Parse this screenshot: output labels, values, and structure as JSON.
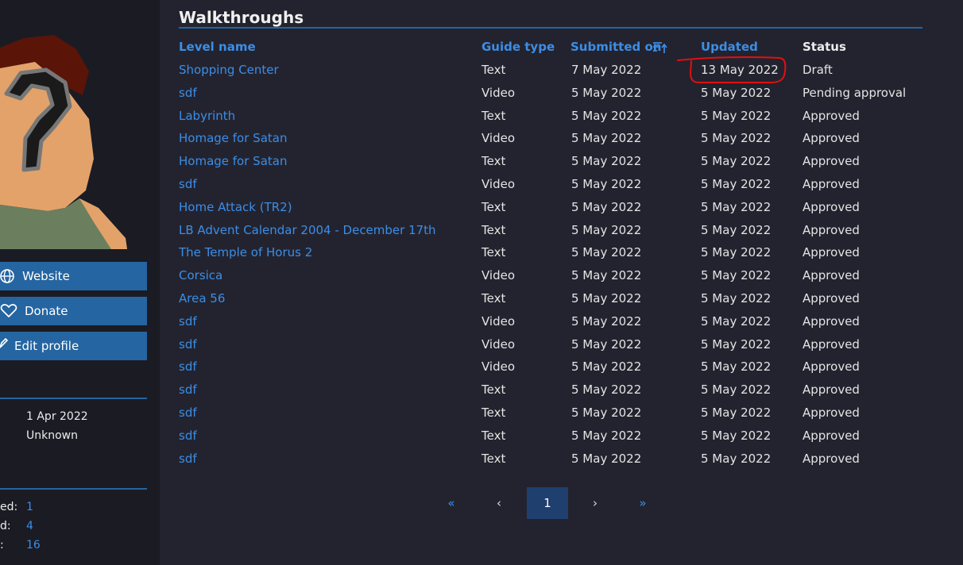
{
  "sidebar": {
    "avatar_icon": "unknown-person-avatar",
    "buttons": [
      {
        "label": "Website",
        "icon": "globe-icon"
      },
      {
        "label": "Donate",
        "icon": "heart-icon"
      },
      {
        "label": "Edit profile",
        "icon": "pencil-icon"
      }
    ],
    "info": {
      "joined_value": "1 Apr 2022",
      "last_value": "Unknown"
    },
    "stats": [
      {
        "label": "ed:",
        "value": "1"
      },
      {
        "label": "d:",
        "value": "4"
      },
      {
        "label": ":",
        "value": "16"
      }
    ]
  },
  "walkthroughs": {
    "title": "Walkthroughs",
    "columns": {
      "level_name": "Level name",
      "guide_type": "Guide type",
      "submitted_on": "Submitted on",
      "updated": "Updated",
      "status": "Status"
    },
    "sort_icon": "sort-ascending-icon",
    "rows": [
      {
        "name": "Shopping Center",
        "type": "Text",
        "submitted": "7 May 2022",
        "updated": "13 May 2022",
        "status": "Draft"
      },
      {
        "name": "sdf",
        "type": "Video",
        "submitted": "5 May 2022",
        "updated": "5 May 2022",
        "status": "Pending approval"
      },
      {
        "name": "Labyrinth",
        "type": "Text",
        "submitted": "5 May 2022",
        "updated": "5 May 2022",
        "status": "Approved"
      },
      {
        "name": "Homage for Satan",
        "type": "Video",
        "submitted": "5 May 2022",
        "updated": "5 May 2022",
        "status": "Approved"
      },
      {
        "name": "Homage for Satan",
        "type": "Text",
        "submitted": "5 May 2022",
        "updated": "5 May 2022",
        "status": "Approved"
      },
      {
        "name": "sdf",
        "type": "Video",
        "submitted": "5 May 2022",
        "updated": "5 May 2022",
        "status": "Approved"
      },
      {
        "name": "Home Attack (TR2)",
        "type": "Text",
        "submitted": "5 May 2022",
        "updated": "5 May 2022",
        "status": "Approved"
      },
      {
        "name": "LB Advent Calendar 2004 - December 17th",
        "type": "Text",
        "submitted": "5 May 2022",
        "updated": "5 May 2022",
        "status": "Approved"
      },
      {
        "name": "The Temple of Horus 2",
        "type": "Text",
        "submitted": "5 May 2022",
        "updated": "5 May 2022",
        "status": "Approved"
      },
      {
        "name": "Corsica",
        "type": "Video",
        "submitted": "5 May 2022",
        "updated": "5 May 2022",
        "status": "Approved"
      },
      {
        "name": "Area 56",
        "type": "Text",
        "submitted": "5 May 2022",
        "updated": "5 May 2022",
        "status": "Approved"
      },
      {
        "name": "sdf",
        "type": "Video",
        "submitted": "5 May 2022",
        "updated": "5 May 2022",
        "status": "Approved"
      },
      {
        "name": "sdf",
        "type": "Video",
        "submitted": "5 May 2022",
        "updated": "5 May 2022",
        "status": "Approved"
      },
      {
        "name": "sdf",
        "type": "Video",
        "submitted": "5 May 2022",
        "updated": "5 May 2022",
        "status": "Approved"
      },
      {
        "name": "sdf",
        "type": "Text",
        "submitted": "5 May 2022",
        "updated": "5 May 2022",
        "status": "Approved"
      },
      {
        "name": "sdf",
        "type": "Text",
        "submitted": "5 May 2022",
        "updated": "5 May 2022",
        "status": "Approved"
      },
      {
        "name": "sdf",
        "type": "Text",
        "submitted": "5 May 2022",
        "updated": "5 May 2022",
        "status": "Approved"
      },
      {
        "name": "sdf",
        "type": "Text",
        "submitted": "5 May 2022",
        "updated": "5 May 2022",
        "status": "Approved"
      }
    ]
  },
  "pagination": {
    "first": "«",
    "prev": "‹",
    "current": "1",
    "next": "›",
    "last": "»"
  },
  "colors": {
    "accent": "#2565a1",
    "link": "#3b8ee6",
    "annotation": "#e01010"
  }
}
